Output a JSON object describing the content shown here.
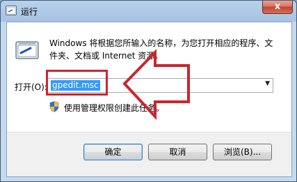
{
  "window": {
    "title": "运行",
    "close_label": "x"
  },
  "dialog": {
    "description": "Windows 将根据您所输入的名称，为您打开相应的程序、文件夹、文档或 Internet 资源。",
    "open_label": "打开(O):",
    "open_value": "gpedit.msc",
    "admin_note": "使用管理权限创建此任务。"
  },
  "buttons": {
    "ok": "确定",
    "cancel": "取消",
    "browse": "浏览(B)..."
  },
  "colors": {
    "annotation": "#c8262f",
    "selection": "#3399ff"
  },
  "icons": {
    "title": "run-icon",
    "main": "run-icon",
    "admin": "shield-icon",
    "dropdown": "chevron-down-icon"
  }
}
